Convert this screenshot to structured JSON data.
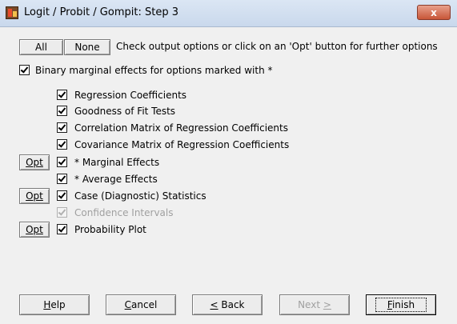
{
  "window": {
    "title": "Logit / Probit / Gompit: Step 3",
    "close_label": "x"
  },
  "toolbar": {
    "all_label": "All",
    "none_label": "None",
    "instruction": "Check output options or click on an 'Opt' button for further options"
  },
  "binary_marginal": {
    "label": "Binary marginal effects for options marked with *",
    "checked": true
  },
  "options": [
    {
      "label": "Regression Coefficients",
      "checked": true,
      "has_opt": false,
      "enabled": true
    },
    {
      "label": "Goodness of Fit Tests",
      "checked": true,
      "has_opt": false,
      "enabled": true
    },
    {
      "label": "Correlation Matrix of Regression Coefficients",
      "checked": true,
      "has_opt": false,
      "enabled": true
    },
    {
      "label": "Covariance Matrix of Regression Coefficients",
      "checked": true,
      "has_opt": false,
      "enabled": true
    },
    {
      "label": "* Marginal Effects",
      "checked": true,
      "has_opt": true,
      "enabled": true
    },
    {
      "label": "* Average Effects",
      "checked": true,
      "has_opt": false,
      "enabled": true
    },
    {
      "label": "Case (Diagnostic) Statistics",
      "checked": true,
      "has_opt": true,
      "enabled": true
    },
    {
      "label": "Confidence Intervals",
      "checked": true,
      "has_opt": false,
      "enabled": false
    },
    {
      "label": "Probability Plot",
      "checked": true,
      "has_opt": true,
      "enabled": true
    }
  ],
  "opt_label": "Opt",
  "footer": {
    "help_hot": "H",
    "help_rest": "elp",
    "cancel_hot": "C",
    "cancel_rest": "ancel",
    "back_hot": "<",
    "back_rest": " Back",
    "next_label": "Next ",
    "next_hot": ">",
    "finish_hot": "F",
    "finish_rest": "inish"
  }
}
